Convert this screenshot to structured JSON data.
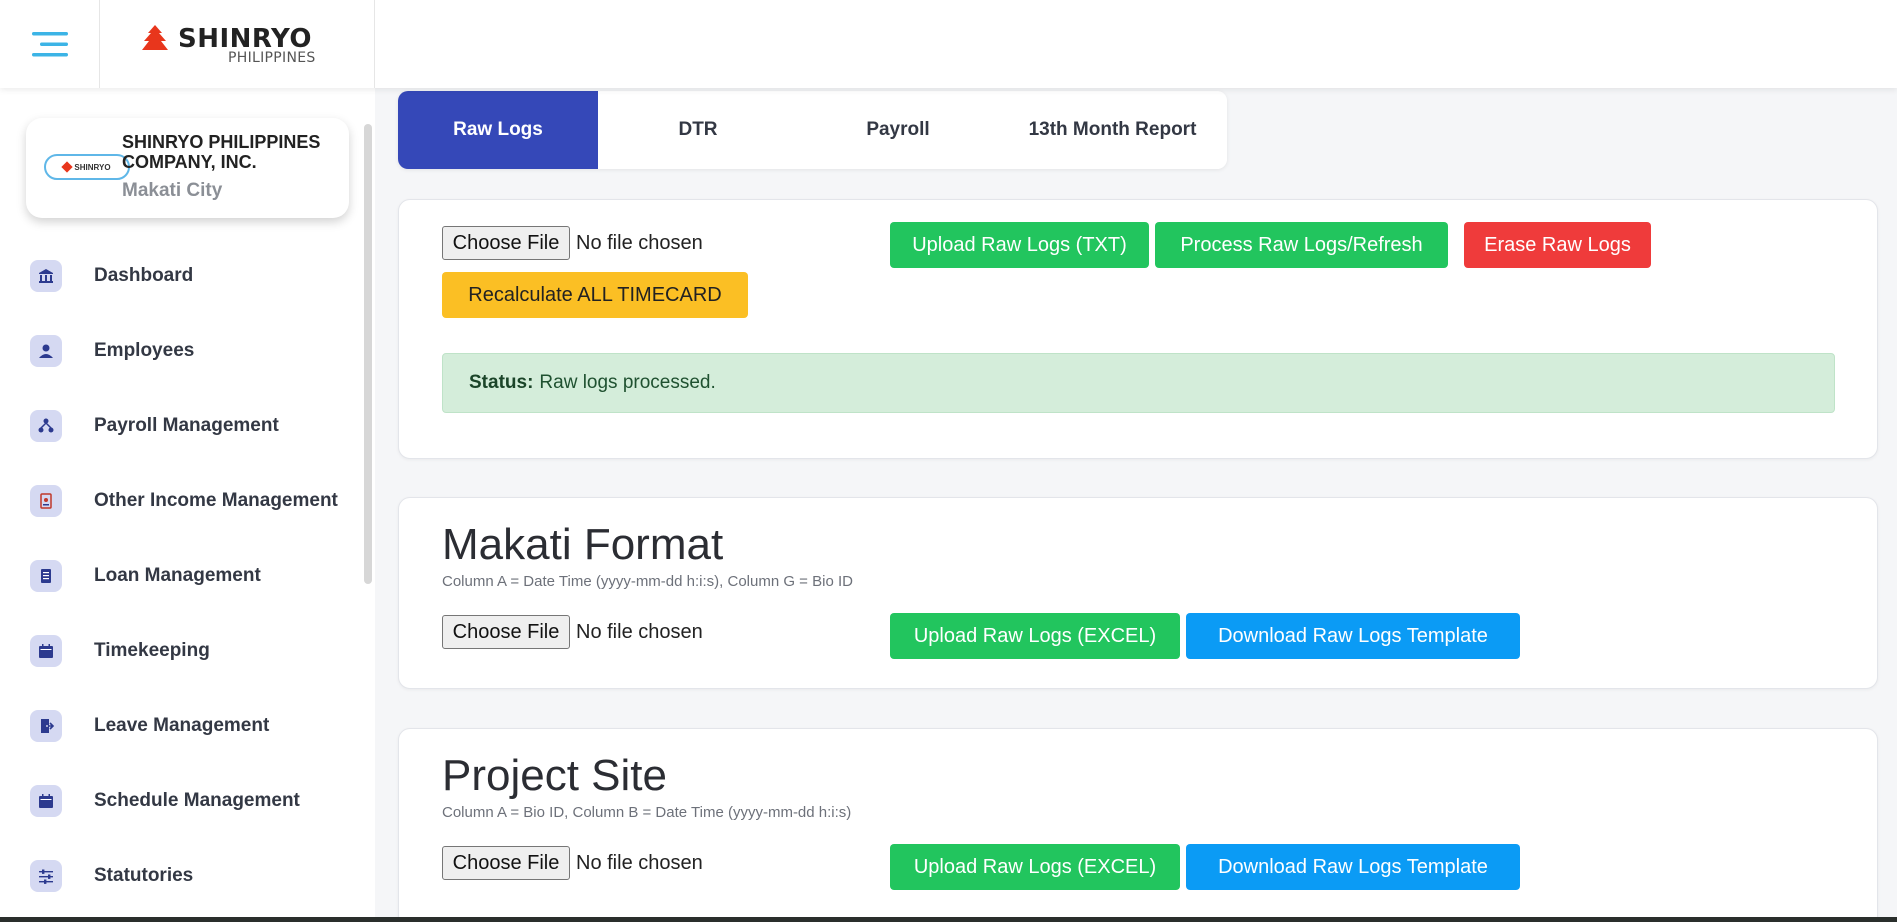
{
  "header": {
    "brand_name": "SHINRYO",
    "brand_sub": "PHILIPPINES"
  },
  "sidebar": {
    "company": {
      "logo_text": "SHINRYO",
      "name": "SHINRYO PHILIPPINES COMPANY, INC.",
      "city": "Makati City"
    },
    "items": [
      {
        "label": "Dashboard",
        "icon": "bank-icon"
      },
      {
        "label": "Employees",
        "icon": "employee-icon"
      },
      {
        "label": "Payroll Management",
        "icon": "network-icon"
      },
      {
        "label": "Other Income Management",
        "icon": "document-icon"
      },
      {
        "label": "Loan Management",
        "icon": "ledger-icon"
      },
      {
        "label": "Timekeeping",
        "icon": "calendar-icon"
      },
      {
        "label": "Leave Management",
        "icon": "door-exit-icon"
      },
      {
        "label": "Schedule Management",
        "icon": "calendar-icon"
      },
      {
        "label": "Statutories",
        "icon": "sliders-icon"
      }
    ]
  },
  "tabs": [
    {
      "label": "Raw Logs",
      "active": true
    },
    {
      "label": "DTR",
      "active": false
    },
    {
      "label": "Payroll",
      "active": false
    },
    {
      "label": "13th Month Report",
      "active": false
    }
  ],
  "raw_logs_card": {
    "choose_file": "Choose File",
    "no_file": "No file chosen",
    "upload_txt": "Upload Raw Logs (TXT)",
    "process": "Process Raw Logs/Refresh",
    "erase": "Erase Raw Logs",
    "recalculate": "Recalculate ALL TIMECARD",
    "status_label": "Status:",
    "status_text": "Raw logs processed."
  },
  "makati_card": {
    "title": "Makati Format",
    "note": "Column A = Date Time (yyyy-mm-dd h:i:s), Column G = Bio ID",
    "choose_file": "Choose File",
    "no_file": "No file chosen",
    "upload": "Upload Raw Logs (EXCEL)",
    "download": "Download Raw Logs Template"
  },
  "project_card": {
    "title": "Project Site",
    "note": "Column A = Bio ID, Column B = Date Time (yyyy-mm-dd h:i:s)",
    "choose_file": "Choose File",
    "no_file": "No file chosen",
    "upload": "Upload Raw Logs (EXCEL)",
    "download": "Download Raw Logs Template"
  },
  "colors": {
    "accent": "#3548b8",
    "green": "#22c55e",
    "red": "#ef3b3b",
    "yellow": "#fbbf24",
    "blue": "#0b9bf5",
    "status_bg": "#d4edda",
    "hamburger": "#3cb4e6"
  }
}
